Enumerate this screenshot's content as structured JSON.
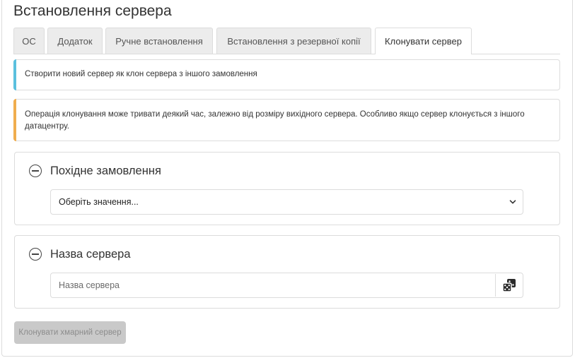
{
  "page": {
    "title": "Встановлення сервера"
  },
  "tabs": [
    {
      "label": "ОС"
    },
    {
      "label": "Додаток"
    },
    {
      "label": "Ручне встановлення"
    },
    {
      "label": "Встановлення з резервної копії"
    },
    {
      "label": "Клонувати сервер",
      "active": true
    }
  ],
  "alerts": {
    "info": {
      "text": "Створити новий сервер як клон сервера з іншого замовлення",
      "color": "#5bc0de"
    },
    "warning": {
      "text": "Операція клонування може тривати деякий час, залежно від розміру вихідного сервера. Особливо якщо сервер клонується з іншого датацентру.",
      "color": "#f0ad4e"
    }
  },
  "source_order": {
    "title": "Похідне замовлення",
    "select_value": "Оберіть значення..."
  },
  "server_name": {
    "title": "Назва сервера",
    "placeholder": "Назва сервера",
    "value": ""
  },
  "actions": {
    "submit_label": "Клонувати хмарний сервер",
    "submit_enabled": false
  },
  "icons": {
    "collapse": "minus-circle-icon",
    "chevron": "chevron-down-icon",
    "generate": "dice-icon"
  }
}
